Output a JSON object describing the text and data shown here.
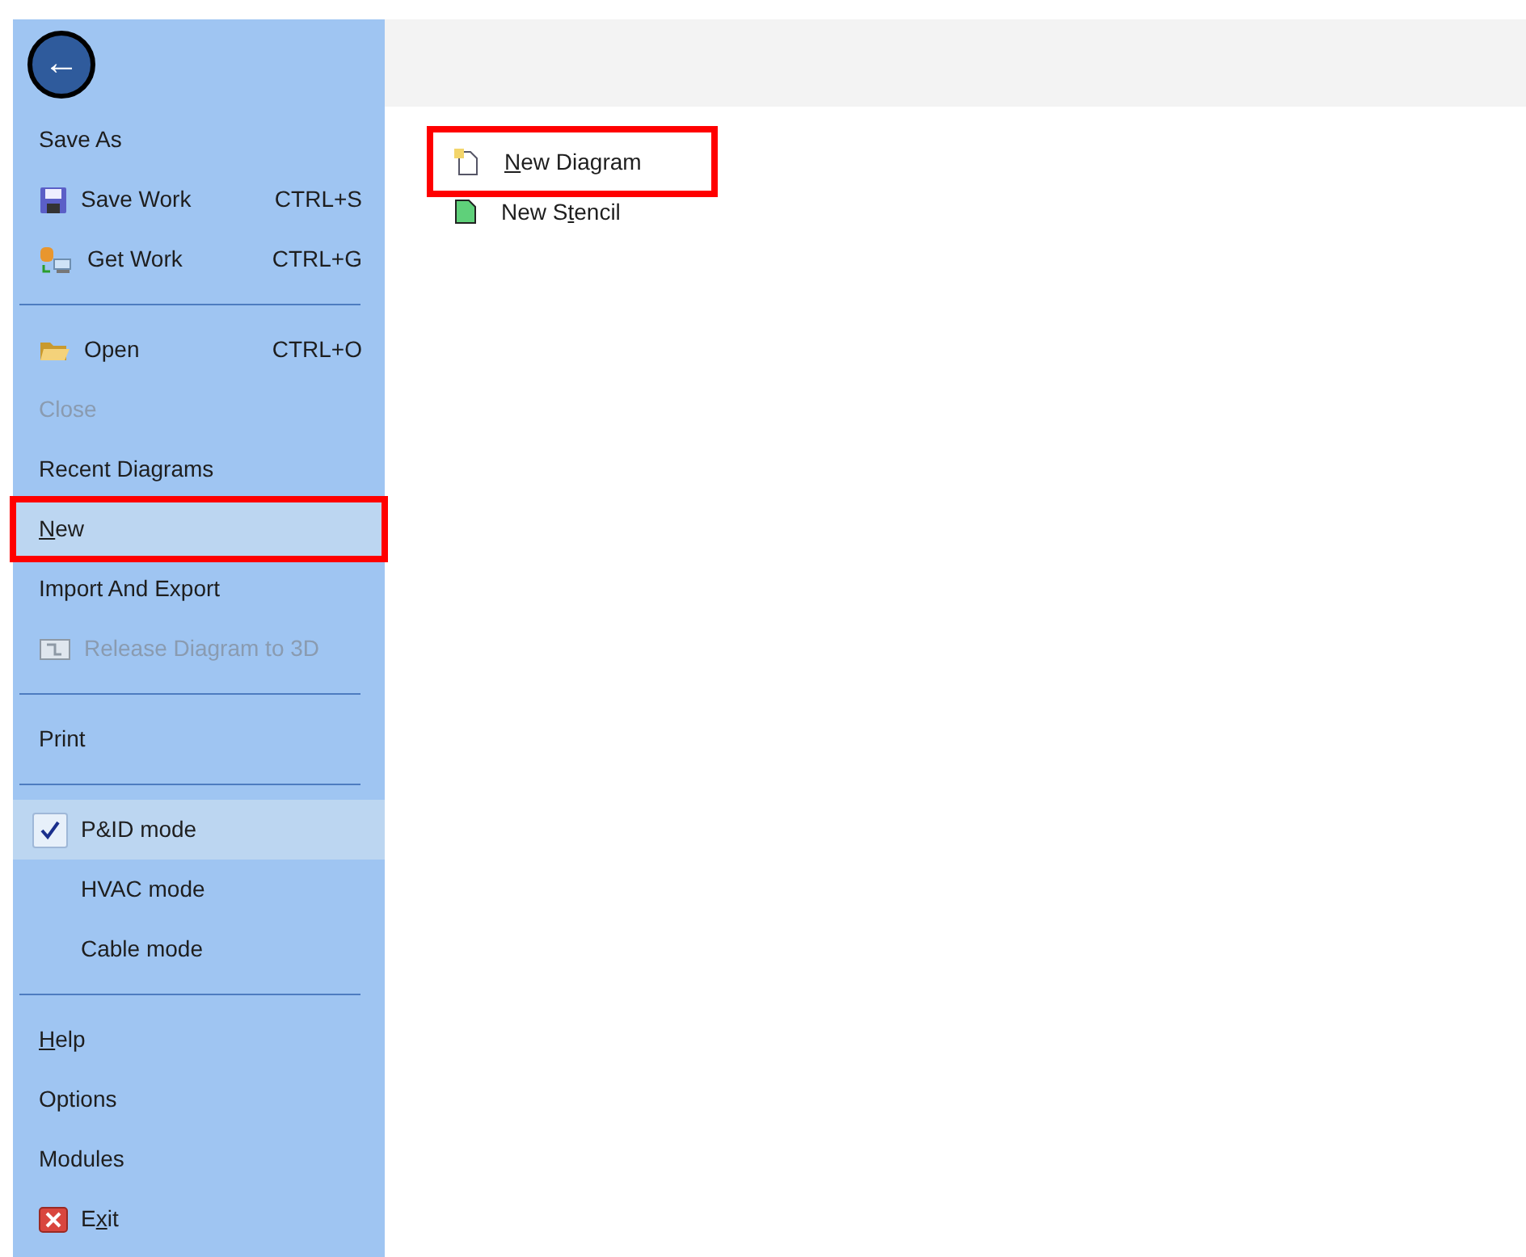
{
  "back_button": {
    "label": "←"
  },
  "menu": [
    {
      "kind": "item",
      "label": "Save As",
      "disabled": false,
      "selected": false,
      "highlighted": false
    },
    {
      "kind": "item",
      "label": "Save Work",
      "shortcut": "CTRL+S",
      "disabled": false,
      "selected": false,
      "highlighted": false
    },
    {
      "kind": "item",
      "label": "Get Work",
      "shortcut": "CTRL+G",
      "disabled": false,
      "selected": false,
      "highlighted": false
    },
    {
      "kind": "separator"
    },
    {
      "kind": "item",
      "label": "Open",
      "shortcut": "CTRL+O",
      "disabled": false,
      "selected": false,
      "highlighted": false
    },
    {
      "kind": "item",
      "label": "Close",
      "disabled": true,
      "selected": false,
      "highlighted": false
    },
    {
      "kind": "item",
      "label": "Recent Diagrams",
      "disabled": false,
      "selected": false,
      "highlighted": false
    },
    {
      "kind": "item",
      "access_key": "N",
      "label_end": "ew",
      "disabled": false,
      "selected": true,
      "highlighted": true
    },
    {
      "kind": "item",
      "label": "Import And Export",
      "disabled": false,
      "selected": false,
      "highlighted": false
    },
    {
      "kind": "item",
      "label": "Release Diagram to 3D",
      "disabled": true,
      "selected": false,
      "highlighted": false
    },
    {
      "kind": "separator"
    },
    {
      "kind": "item",
      "label": "Print",
      "disabled": false,
      "selected": false,
      "highlighted": false
    },
    {
      "kind": "separator"
    },
    {
      "kind": "mode",
      "label": "P&ID mode",
      "checked": true
    },
    {
      "kind": "mode",
      "label": "HVAC mode",
      "checked": false
    },
    {
      "kind": "mode",
      "label": "Cable mode",
      "checked": false
    },
    {
      "kind": "separator"
    },
    {
      "kind": "item",
      "access_key": "H",
      "label_end": "elp",
      "disabled": false,
      "selected": false,
      "highlighted": false
    },
    {
      "kind": "item",
      "label": "Options",
      "disabled": false,
      "selected": false,
      "highlighted": false
    },
    {
      "kind": "item",
      "label": "Modules",
      "disabled": false,
      "selected": false,
      "highlighted": false
    },
    {
      "kind": "item",
      "label_start": "E",
      "access_key": "x",
      "label_end": "it",
      "disabled": false,
      "selected": false,
      "highlighted": false
    }
  ],
  "options": [
    {
      "access_key": "N",
      "label_end": "ew Diagram",
      "highlighted": true
    },
    {
      "label_start": "New S",
      "access_key": "t",
      "label_end": "encil",
      "highlighted": false
    }
  ]
}
